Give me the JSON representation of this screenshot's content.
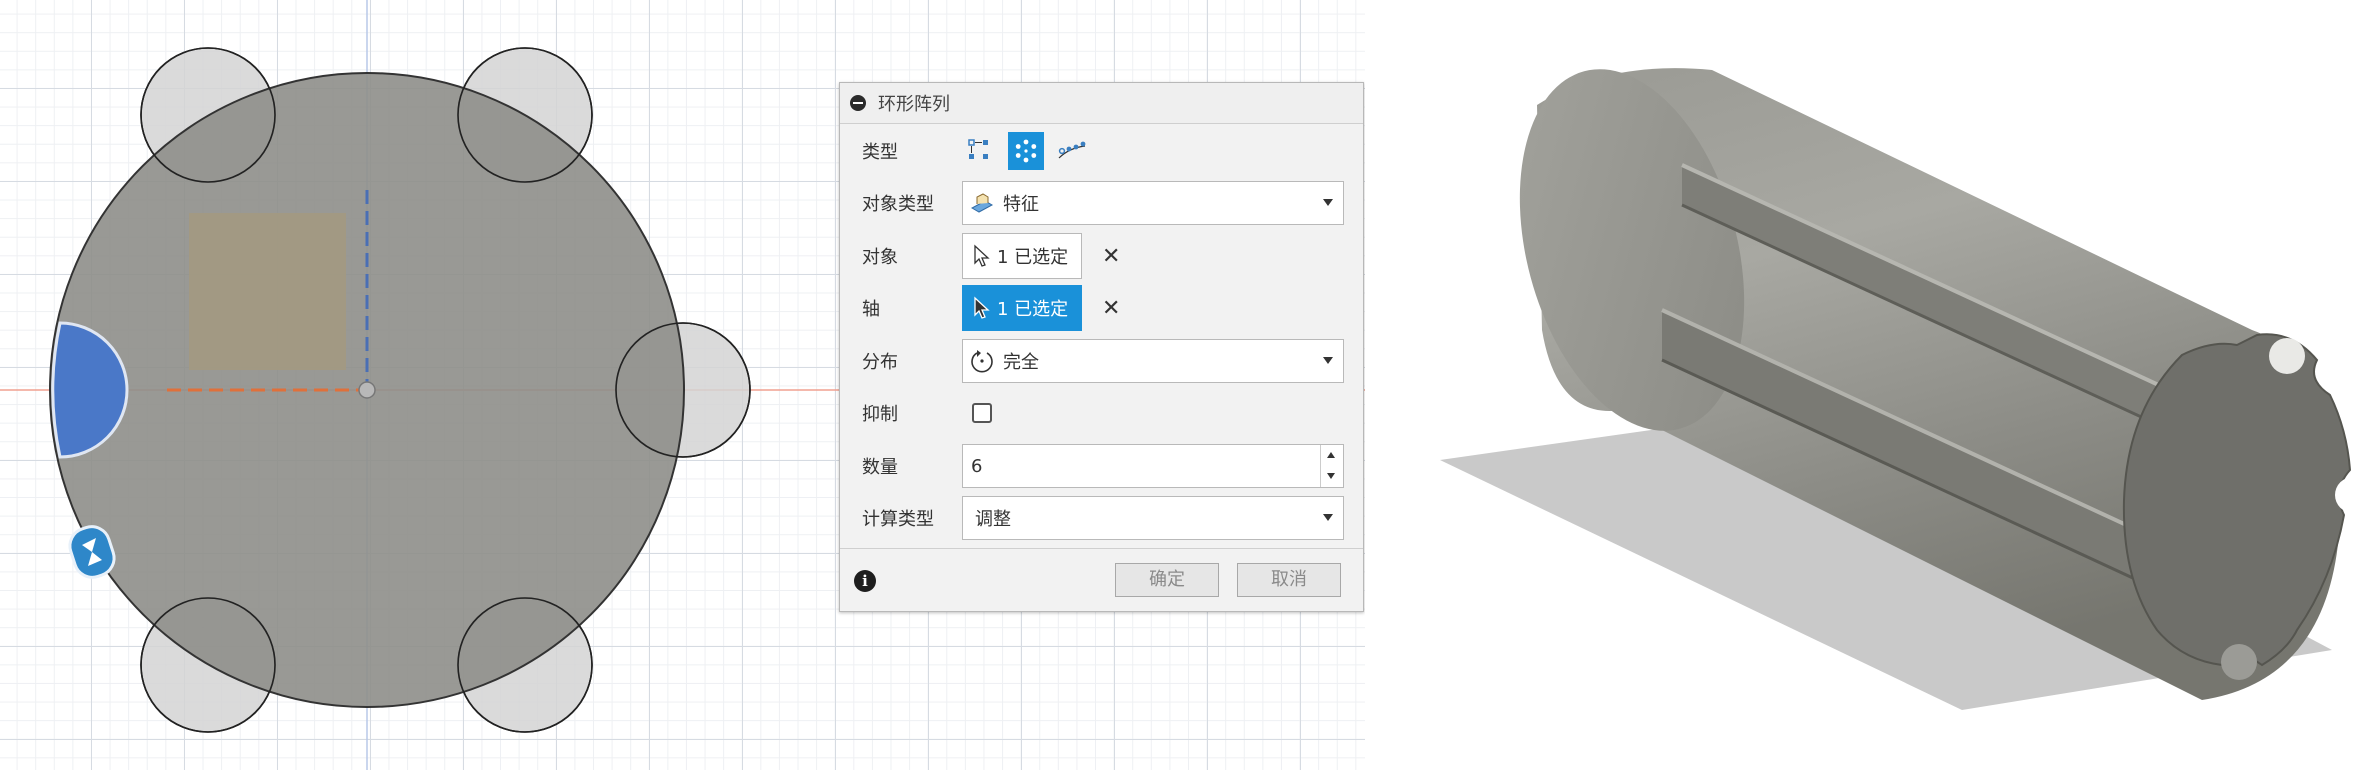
{
  "dialog": {
    "title": "环形阵列",
    "rows": {
      "type": {
        "label": "类型"
      },
      "object_type": {
        "label": "对象类型",
        "value": "特征"
      },
      "objects": {
        "label": "对象",
        "selection": "1 已选定"
      },
      "axis": {
        "label": "轴",
        "selection": "1 已选定"
      },
      "distribution": {
        "label": "分布",
        "value": "完全"
      },
      "suppress": {
        "label": "抑制",
        "checked": false
      },
      "quantity": {
        "label": "数量",
        "value": "6"
      },
      "compute_type": {
        "label": "计算类型",
        "value": "调整"
      }
    },
    "ok_label": "确定",
    "cancel_label": "取消"
  },
  "colors": {
    "accent": "#1a91d9",
    "body_fill": "#8e8e89",
    "selected_face": "#4a78c8",
    "sketch_rect": "#a59a7e",
    "model_gray": "#8f8f8a"
  },
  "icons": [
    "collapse-icon",
    "rectangular-pattern-icon",
    "circular-pattern-icon",
    "path-pattern-icon",
    "feature-icon",
    "cursor-select-icon",
    "clear-x-icon",
    "distribution-icon",
    "info-icon",
    "view-cube-arrows-icon"
  ]
}
